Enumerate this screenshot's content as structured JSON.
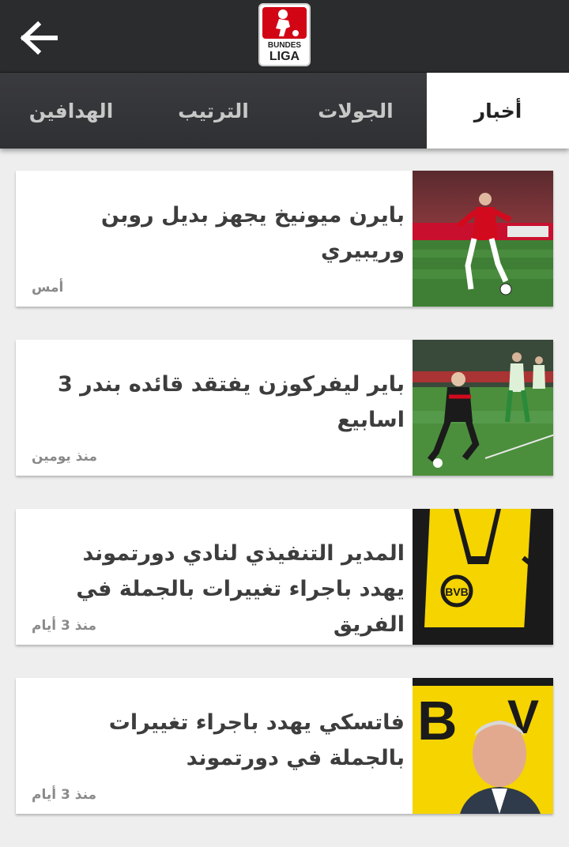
{
  "header": {
    "back_icon": "arrow-left-icon",
    "logo_top": "BUNDES",
    "logo_bottom": "LIGA"
  },
  "tabs": [
    {
      "label": "أخبار",
      "active": true
    },
    {
      "label": "الجولات",
      "active": false
    },
    {
      "label": "الترتيب",
      "active": false
    },
    {
      "label": "الهدافين",
      "active": false
    }
  ],
  "articles": [
    {
      "title": "بايرن ميونيخ يجهز بديل روبن وريبيري",
      "time": "أمس",
      "image": "bayern-player-photo"
    },
    {
      "title": "باير ليفركوزن يفتقد قائده بندر 3 اسابيع",
      "time": "منذ يومين",
      "image": "leverkusen-player-photo"
    },
    {
      "title": "المدير التنفيذي لنادي دورتموند يهدد باجراء تغييرات بالجملة في الفريق",
      "time": "منذ 3 أيام",
      "image": "dortmund-jersey-photo"
    },
    {
      "title": "فاتسكي يهدد باجراء تغييرات بالجملة في دورتموند",
      "time": "منذ 3 أيام",
      "image": "watzke-portrait-photo"
    }
  ],
  "colors": {
    "header_bg": "#2b2c2e",
    "tab_active_bg": "#ffffff",
    "dortmund_yellow": "#f5d400",
    "bundesliga_red": "#d20515"
  }
}
